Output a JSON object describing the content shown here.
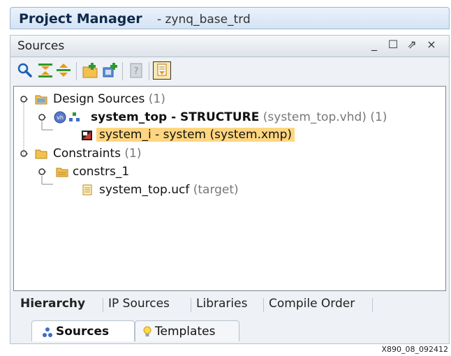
{
  "header": {
    "title": "Project Manager",
    "subtitle": "- zynq_base_trd"
  },
  "panel": {
    "title": "Sources",
    "controls": {
      "minimize": "_",
      "maximize": "☐",
      "float": "⇗",
      "close": "×"
    }
  },
  "toolbar": {
    "icons": [
      "search-icon",
      "collapse-all-icon",
      "expand-all-icon",
      "add-sources-icon",
      "add-ip-icon",
      "properties-icon",
      "show-hierarchy-icon"
    ]
  },
  "tree": {
    "design_sources": {
      "label": "Design Sources",
      "count": "(1)"
    },
    "system_top": {
      "label": "system_top - STRUCTURE",
      "file": "(system_top.vhd)",
      "count": "(1)",
      "badge": "vh"
    },
    "system_i": {
      "label": "system_i - system (system.xmp)"
    },
    "constraints": {
      "label": "Constraints",
      "count": "(1)"
    },
    "constrs_1": {
      "label": "constrs_1"
    },
    "ucf": {
      "label": "system_top.ucf",
      "note": "(target)"
    }
  },
  "view_tabs": [
    "Hierarchy",
    "IP Sources",
    "Libraries",
    "Compile Order"
  ],
  "outer_tabs": {
    "sources": "Sources",
    "templates": "Templates"
  },
  "figure_id": "X890_08_092412",
  "colors": {
    "selection": "#ffd680",
    "header_text": "#10294a"
  }
}
